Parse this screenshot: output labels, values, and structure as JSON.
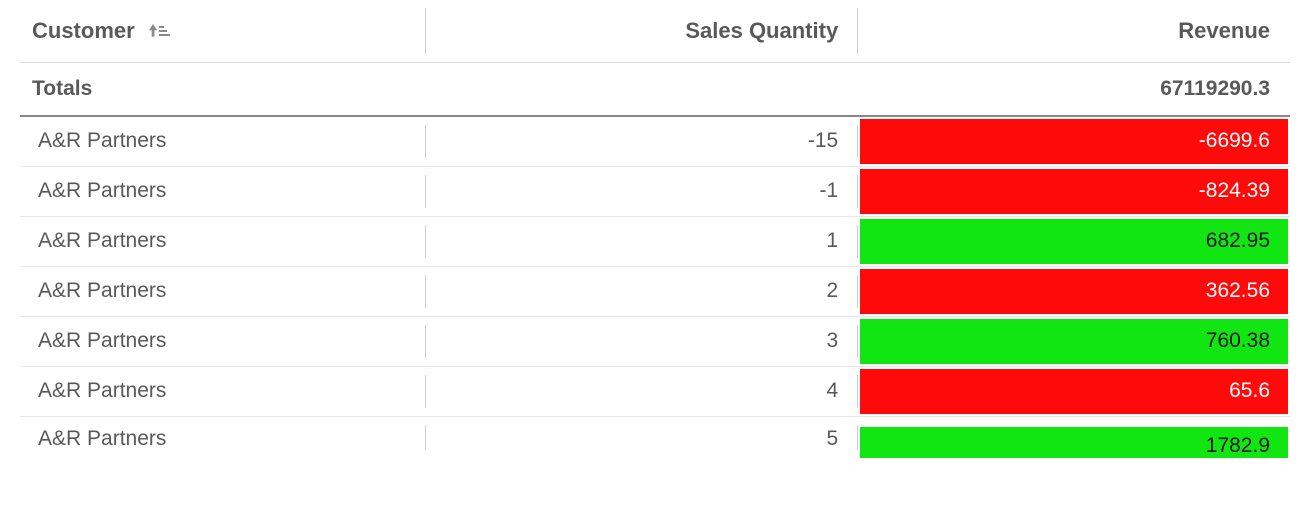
{
  "table": {
    "headers": {
      "customer": "Customer",
      "sales_quantity": "Sales Quantity",
      "revenue": "Revenue"
    },
    "sort_indicator": "↑≡",
    "totals": {
      "label": "Totals",
      "sales_quantity": "",
      "revenue": "67119290.3"
    },
    "rows": [
      {
        "customer": "A&R Partners",
        "sales_quantity": "-15",
        "revenue": "-6699.6",
        "revenue_class": "neg"
      },
      {
        "customer": "A&R Partners",
        "sales_quantity": "-1",
        "revenue": "-824.39",
        "revenue_class": "neg"
      },
      {
        "customer": "A&R Partners",
        "sales_quantity": "1",
        "revenue": "682.95",
        "revenue_class": "pos"
      },
      {
        "customer": "A&R Partners",
        "sales_quantity": "2",
        "revenue": "362.56",
        "revenue_class": "neg"
      },
      {
        "customer": "A&R Partners",
        "sales_quantity": "3",
        "revenue": "760.38",
        "revenue_class": "pos"
      },
      {
        "customer": "A&R Partners",
        "sales_quantity": "4",
        "revenue": "65.6",
        "revenue_class": "neg"
      },
      {
        "customer": "A&R Partners",
        "sales_quantity": "5",
        "revenue": "1782.9",
        "revenue_class": "pos"
      }
    ]
  },
  "colors": {
    "positive_bg": "#12e612",
    "negative_bg": "#ff0a0a"
  }
}
